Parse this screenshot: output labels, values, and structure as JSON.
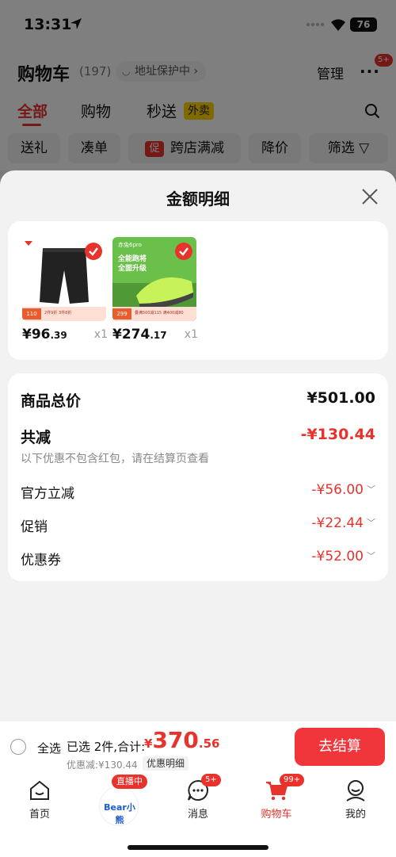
{
  "status_bar": {
    "time": "13:31",
    "battery": "76"
  },
  "header": {
    "title": "购物车",
    "count": "(197)",
    "address_chip": "地址保护中",
    "address_arrow": "›",
    "manage": "管理",
    "more_badge": "5+"
  },
  "tabs": [
    {
      "label": "全部"
    },
    {
      "label": "购物"
    },
    {
      "label": "秒送"
    }
  ],
  "takeout_tag": "外卖",
  "filters": {
    "gift": "送礼",
    "bundle": "凑单",
    "cross_store_badge": "促",
    "cross_store": "跨店满减",
    "price_drop": "降价",
    "filter": "筛选"
  },
  "sheet": {
    "title": "金额明细",
    "products": [
      {
        "price_int": "¥96",
        "price_dec": ".39",
        "qty": "x1",
        "strip_tag": "110",
        "strip_text": "2件9折 3件8折"
      },
      {
        "price_int": "¥274",
        "price_dec": ".17",
        "qty": "x1",
        "strip_tag": "299",
        "strip_text": "叠满500减115 满400减80"
      }
    ],
    "shoe_banner_brand": "赤兔6pro",
    "shoe_banner_line1": "全能跑将",
    "shoe_banner_line2": "全面升级",
    "details": {
      "subtotal_label": "商品总价",
      "subtotal_value": "¥501.00",
      "discount_label": "共减",
      "discount_value": "-¥130.44",
      "note": "以下优惠不包含红包，请在结算页查看",
      "official_label": "官方立减",
      "official_value": "-¥56.00",
      "promo_label": "促销",
      "promo_value": "-¥22.44",
      "coupon_label": "优惠券",
      "coupon_value": "-¥52.00"
    }
  },
  "checkout": {
    "select_all": "全选",
    "summary": "已选 2件,合计:",
    "total_yen": "¥",
    "total_int": "370",
    "total_dec": ".56",
    "discount_line": "优惠减:¥130.44",
    "discount_detail_btn": "优惠明细",
    "checkout_btn": "去结算"
  },
  "tabbar": {
    "home": "首页",
    "live_badge": "直播中",
    "brand_logo_text": "Bear小熊",
    "messages": "消息",
    "messages_badge": "5+",
    "cart": "购物车",
    "cart_badge": "99+",
    "mine": "我的"
  },
  "colors": {
    "accent": "#e8322c",
    "checkout_button": "#f0353b",
    "takeout_tag": "#ffd400"
  }
}
